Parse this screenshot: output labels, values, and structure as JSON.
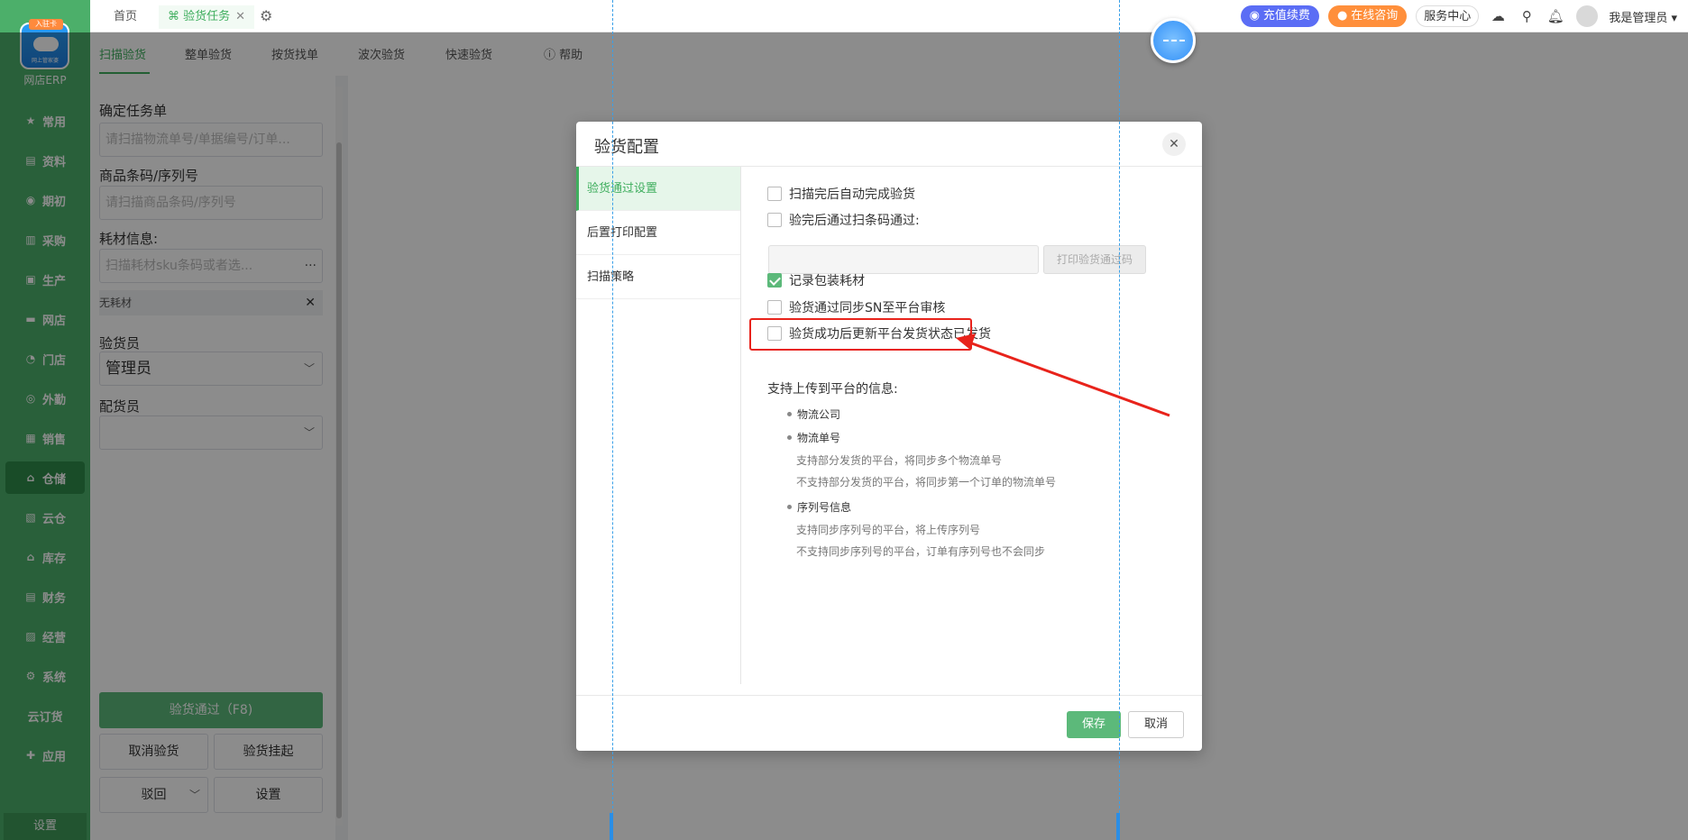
{
  "sidebar": {
    "logo_badge": "入驻卡",
    "logo_caption": "网上管家婆",
    "logo_text": "网店ERP",
    "items": [
      {
        "label": "常用",
        "icon": "★"
      },
      {
        "label": "资料",
        "icon": "▤"
      },
      {
        "label": "期初",
        "icon": "◉"
      },
      {
        "label": "采购",
        "icon": "▥"
      },
      {
        "label": "生产",
        "icon": "▣"
      },
      {
        "label": "网店",
        "icon": "▬"
      },
      {
        "label": "门店",
        "icon": "◔"
      },
      {
        "label": "外勤",
        "icon": "◎"
      },
      {
        "label": "销售",
        "icon": "▦"
      },
      {
        "label": "仓储",
        "icon": "⌂"
      },
      {
        "label": "云仓",
        "icon": "▧"
      },
      {
        "label": "库存",
        "icon": "⌂"
      },
      {
        "label": "财务",
        "icon": "▤"
      },
      {
        "label": "经营",
        "icon": "▨"
      },
      {
        "label": "系统",
        "icon": "⚙"
      },
      {
        "label": "云订货",
        "icon": ""
      },
      {
        "label": "应用",
        "icon": "✚"
      }
    ],
    "bottom": "设置"
  },
  "topbar": {
    "tab_home": "首页",
    "tab_active": "验货任务",
    "pill_recharge": "充值续费",
    "pill_consult": "在线咨询",
    "service": "服务中心",
    "user": "我是管理员"
  },
  "subnav": {
    "tabs": [
      "扫描验货",
      "整单验货",
      "按货找单",
      "波次验货",
      "快速验货"
    ],
    "help": "帮助"
  },
  "panel": {
    "task_label": "确定任务单",
    "task_placeholder": "请扫描物流单号/单据编号/订单...",
    "barcode_label": "商品条码/序列号",
    "barcode_placeholder": "请扫描商品条码/序列号",
    "material_label": "耗材信息:",
    "material_placeholder": "扫描耗材sku条码或者选...",
    "material_more": "···",
    "material_tag": "无耗材",
    "inspector_label": "验货员",
    "inspector_value": "管理员",
    "distributor_label": "配货员",
    "distributor_value": "",
    "btn_pass": "验货通过（F8)",
    "btn_cancel": "取消验货",
    "btn_hold": "验货挂起",
    "btn_reject": "驳回",
    "btn_settings": "设置"
  },
  "dialog": {
    "title": "验货配置",
    "menu": [
      "验货通过设置",
      "后置打印配置",
      "扫描策略"
    ],
    "options": [
      {
        "label": "扫描完后自动完成验货",
        "checked": false
      },
      {
        "label": "验完后通过扫条码通过:",
        "checked": false
      },
      {
        "label": "记录包装耗材",
        "checked": true
      },
      {
        "label": "验货通过同步SN至平台审核",
        "checked": false
      },
      {
        "label": "验货成功后更新平台发货状态已发货",
        "checked": false
      }
    ],
    "print_button": "打印验货通过码",
    "info_head": "支持上传到平台的信息:",
    "bullets": [
      "物流公司",
      "物流单号",
      "序列号信息"
    ],
    "notes": [
      "支持部分发货的平台，将同步多个物流单号",
      "不支持部分发货的平台，将同步第一个订单的物流单号",
      "支持同步序列号的平台，将上传序列号",
      "不支持同步序列号的平台，订单有序列号也不会同步"
    ],
    "save": "保存",
    "cancel": "取消"
  },
  "colors": {
    "brand_green": "#4caf6a",
    "highlight_red": "#e8231b",
    "guide_blue": "#3aa0e8"
  }
}
